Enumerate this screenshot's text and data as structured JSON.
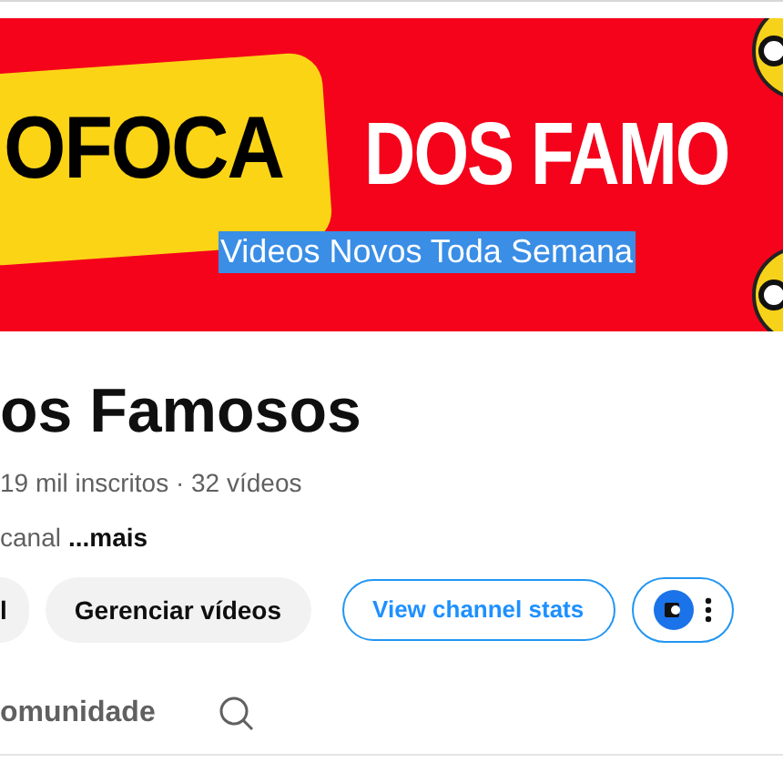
{
  "banner": {
    "tag_text": "OFOCA",
    "headline": "DOS FAMO",
    "subtitle": "Videos Novos Toda Semana",
    "subtitle_selected": true
  },
  "channel": {
    "title": "os Famosos",
    "stats": "19 mil inscritos · 32 vídeos",
    "description": "canal",
    "more_link": "...mais"
  },
  "buttons": [
    {
      "label": "l",
      "kind": "grey"
    },
    {
      "label": "Gerenciar vídeos",
      "kind": "grey"
    },
    {
      "label": "View channel stats",
      "kind": "outline"
    },
    {
      "kind": "icon-menu"
    }
  ],
  "tabs": [
    {
      "label": "omunidade",
      "selected": false
    }
  ]
}
